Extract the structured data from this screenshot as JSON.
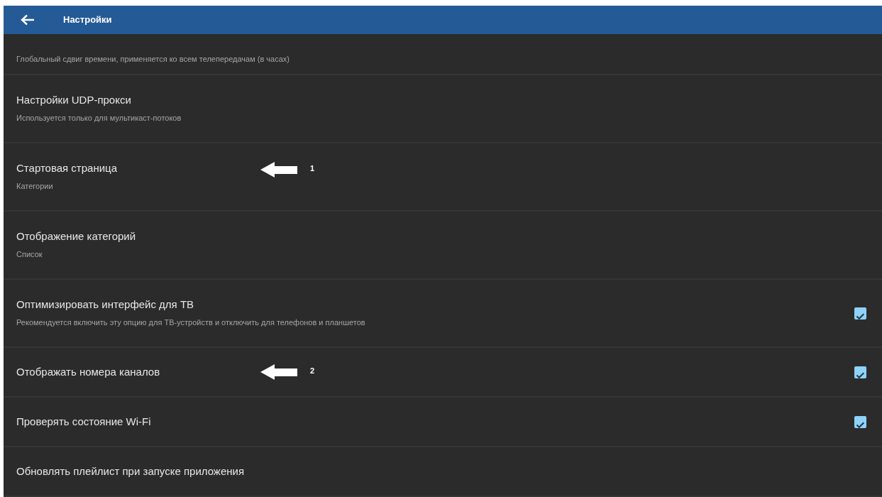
{
  "app_bar": {
    "title": "Настройки"
  },
  "items": [
    {
      "kind": "info",
      "subtitle": "Глобальный сдвиг времени, применяется ко всем телепередачам (в часах)"
    },
    {
      "kind": "info",
      "title": "Настройки UDP-прокси",
      "subtitle": "Используется только для мультикаст-потоков"
    },
    {
      "kind": "info",
      "title": "Стартовая страница",
      "subtitle": "Категории",
      "annotation": "1"
    },
    {
      "kind": "info",
      "title": "Отображение категорий",
      "subtitle": "Список"
    },
    {
      "kind": "checkbox",
      "title": "Оптимизировать интерфейс для ТВ",
      "subtitle": "Рекомендуется включить эту опцию для ТВ-устройств и отключить для телефонов и планшетов",
      "checked": true
    },
    {
      "kind": "checkbox",
      "title": "Отображать номера каналов",
      "checked": true,
      "annotation": "2"
    },
    {
      "kind": "checkbox",
      "title": "Проверять состояние Wi-Fi",
      "checked": true
    },
    {
      "kind": "info",
      "title": "Обновлять плейлист при запуске приложения"
    }
  ]
}
